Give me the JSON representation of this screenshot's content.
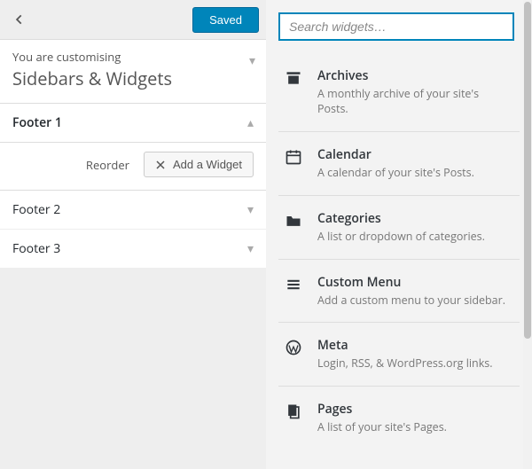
{
  "topbar": {
    "saved_label": "Saved"
  },
  "section": {
    "customising": "You are customising",
    "title": "Sidebars & Widgets"
  },
  "footers": {
    "0": {
      "label": "Footer 1",
      "reorder": "Reorder",
      "add_widget": "Add a Widget"
    },
    "1": {
      "label": "Footer 2"
    },
    "2": {
      "label": "Footer 3"
    }
  },
  "search": {
    "placeholder": "Search widgets…"
  },
  "widgets": {
    "0": {
      "title": "Archives",
      "desc": "A monthly archive of your site's Posts."
    },
    "1": {
      "title": "Calendar",
      "desc": "A calendar of your site's Posts."
    },
    "2": {
      "title": "Categories",
      "desc": "A list or dropdown of categories."
    },
    "3": {
      "title": "Custom Menu",
      "desc": "Add a custom menu to your sidebar."
    },
    "4": {
      "title": "Meta",
      "desc": "Login, RSS, & WordPress.org links."
    },
    "5": {
      "title": "Pages",
      "desc": "A list of your site's Pages."
    }
  }
}
